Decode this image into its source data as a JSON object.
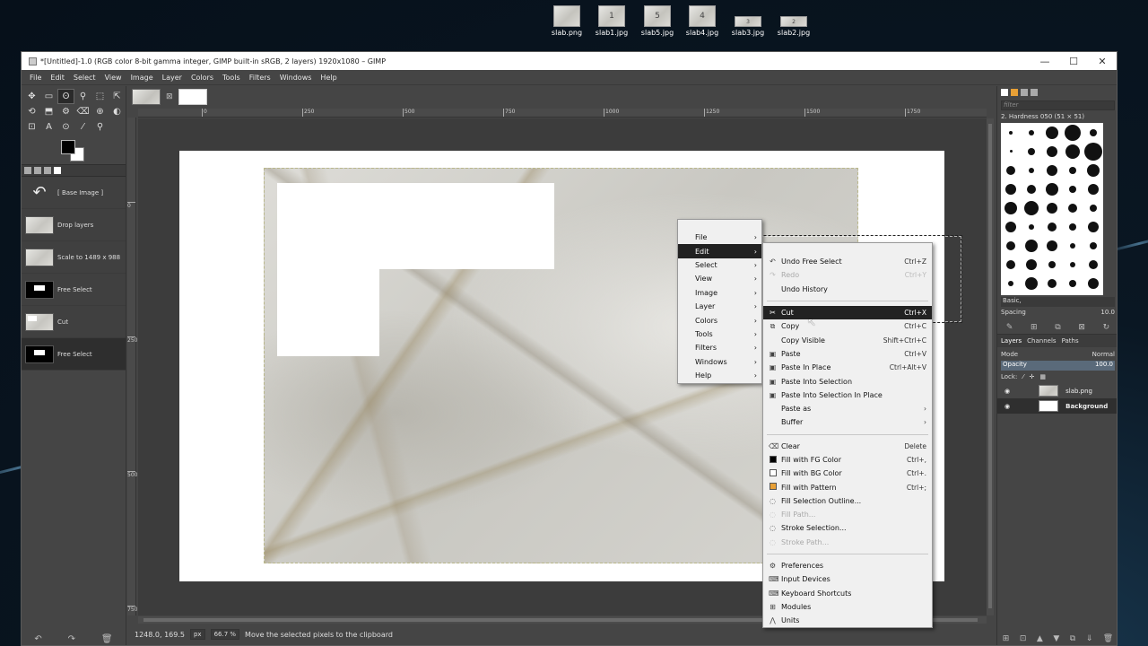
{
  "desktop": {
    "icons": [
      {
        "label": "slab.png",
        "glyph": ""
      },
      {
        "label": "slab1.jpg",
        "glyph": "1"
      },
      {
        "label": "slab5.jpg",
        "glyph": "5"
      },
      {
        "label": "slab4.jpg",
        "glyph": "4"
      },
      {
        "label": "slab3.jpg",
        "glyph": "3"
      },
      {
        "label": "slab2.jpg",
        "glyph": "2"
      }
    ]
  },
  "window": {
    "title": "*[Untitled]-1.0 (RGB color 8-bit gamma integer, GIMP built-in sRGB, 2 layers) 1920x1080 – GIMP",
    "controls": {
      "minimize": "—",
      "maximize": "☐",
      "close": "✕"
    }
  },
  "menubar": [
    "File",
    "Edit",
    "Select",
    "View",
    "Image",
    "Layer",
    "Colors",
    "Tools",
    "Filters",
    "Windows",
    "Help"
  ],
  "toolbox": {
    "tools": [
      "✥",
      "▭",
      "ʘ",
      "⚲",
      "⬚",
      "⇱",
      "⟲",
      "⬒",
      "⚙",
      "⌫",
      "⊕",
      "◐",
      "⊡",
      "A",
      "⊙",
      "⁄",
      "⚲",
      ""
    ],
    "undo_history": [
      {
        "label": "[ Base Image ]",
        "thumb": "undo"
      },
      {
        "label": "Drop layers",
        "thumb": "img"
      },
      {
        "label": "Scale to 1489 x 988",
        "thumb": "img"
      },
      {
        "label": "Free Select",
        "thumb": "mask"
      },
      {
        "label": "Cut",
        "thumb": "cut"
      },
      {
        "label": "Free Select",
        "thumb": "mask",
        "selected": true
      }
    ],
    "bottom_icons": [
      "↶",
      "↷",
      "🗑"
    ]
  },
  "canvas": {
    "close_tab": "⊠",
    "ruler_h": [
      "0",
      "250",
      "500",
      "750",
      "1000",
      "1250",
      "1500",
      "1750"
    ],
    "ruler_v": [
      "0",
      "250",
      "500",
      "750"
    ]
  },
  "statusbar": {
    "coords": "1248.0, 169.5",
    "unit": "px",
    "zoom": "66.7 %",
    "message": "Move the selected pixels to the clipboard"
  },
  "right_dock": {
    "filter_placeholder": "filter",
    "brush_name": "2. Hardness 050 (51 × 51)",
    "preset": "Basic,",
    "spacing_label": "Spacing",
    "spacing_value": "10.0",
    "layer_tabs": [
      "Layers",
      "Channels",
      "Paths"
    ],
    "mode_label": "Mode",
    "mode_value": "Normal",
    "opacity_label": "Opacity",
    "opacity_value": "100.0",
    "lock_label": "Lock:",
    "layers": [
      {
        "name": "slab.png",
        "thumb": "slab",
        "selected": false
      },
      {
        "name": "Background",
        "thumb": "white",
        "selected": true
      }
    ],
    "bottom_icons": [
      "⊞",
      "⊡",
      "▲",
      "▼",
      "⧉",
      "⇓",
      "🗑"
    ]
  },
  "main_menu": [
    {
      "label": "File"
    },
    {
      "label": "Edit",
      "highlighted": true
    },
    {
      "label": "Select"
    },
    {
      "label": "View"
    },
    {
      "label": "Image"
    },
    {
      "label": "Layer"
    },
    {
      "label": "Colors"
    },
    {
      "label": "Tools"
    },
    {
      "label": "Filters"
    },
    {
      "label": "Windows"
    },
    {
      "label": "Help"
    }
  ],
  "edit_menu": {
    "group1": [
      {
        "label": "Undo Free Select",
        "shortcut": "Ctrl+Z",
        "icon": "↶"
      },
      {
        "label": "Redo",
        "shortcut": "Ctrl+Y",
        "icon": "↷",
        "disabled": true
      },
      {
        "label": "Undo History",
        "shortcut": "",
        "icon": ""
      }
    ],
    "group2": [
      {
        "label": "Cut",
        "shortcut": "Ctrl+X",
        "icon": "✂",
        "highlighted": true
      },
      {
        "label": "Copy",
        "shortcut": "Ctrl+C",
        "icon": "⧉"
      },
      {
        "label": "Copy Visible",
        "shortcut": "Shift+Ctrl+C",
        "icon": ""
      },
      {
        "label": "Paste",
        "shortcut": "Ctrl+V",
        "icon": "▣"
      },
      {
        "label": "Paste In Place",
        "shortcut": "Ctrl+Alt+V",
        "icon": "▣"
      },
      {
        "label": "Paste Into Selection",
        "shortcut": "",
        "icon": "▣"
      },
      {
        "label": "Paste Into Selection In Place",
        "shortcut": "",
        "icon": "▣"
      },
      {
        "label": "Paste as",
        "shortcut": "",
        "icon": "",
        "submenu": true
      },
      {
        "label": "Buffer",
        "shortcut": "",
        "icon": "",
        "submenu": true
      }
    ],
    "group3": [
      {
        "label": "Clear",
        "shortcut": "Delete",
        "icon": "⌫"
      },
      {
        "label": "Fill with FG Color",
        "shortcut": "Ctrl+,",
        "swatch": "#000000"
      },
      {
        "label": "Fill with BG Color",
        "shortcut": "Ctrl+.",
        "swatch": "#ffffff"
      },
      {
        "label": "Fill with Pattern",
        "shortcut": "Ctrl+;",
        "swatch": "#e8a036"
      },
      {
        "label": "Fill Selection Outline...",
        "shortcut": "",
        "icon": "◌"
      },
      {
        "label": "Fill Path...",
        "shortcut": "",
        "icon": "◌",
        "disabled": true
      },
      {
        "label": "Stroke Selection...",
        "shortcut": "",
        "icon": "◌"
      },
      {
        "label": "Stroke Path...",
        "shortcut": "",
        "icon": "◌",
        "disabled": true
      }
    ],
    "group4": [
      {
        "label": "Preferences",
        "shortcut": "",
        "icon": "⚙"
      },
      {
        "label": "Input Devices",
        "shortcut": "",
        "icon": "⌨"
      },
      {
        "label": "Keyboard Shortcuts",
        "shortcut": "",
        "icon": "⌨"
      },
      {
        "label": "Modules",
        "shortcut": "",
        "icon": "⊞"
      },
      {
        "label": "Units",
        "shortcut": "",
        "icon": "⋀"
      }
    ]
  }
}
